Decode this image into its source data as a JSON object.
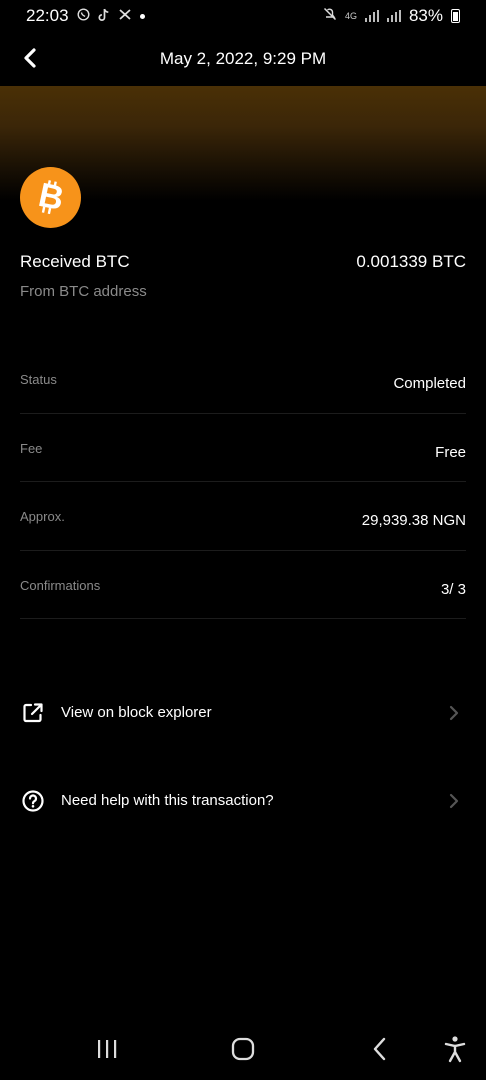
{
  "status_bar": {
    "time": "22:03",
    "battery": "83%",
    "network": "4G"
  },
  "header": {
    "title": "May 2, 2022, 9:29 PM"
  },
  "summary": {
    "title": "Received BTC",
    "amount": "0.001339 BTC",
    "subtitle": "From BTC address",
    "coin_color": "#f7931a"
  },
  "details": [
    {
      "label": "Status",
      "value": "Completed"
    },
    {
      "label": "Fee",
      "value": "Free"
    },
    {
      "label": "Approx.",
      "value": "29,939.38 NGN"
    },
    {
      "label": "Confirmations",
      "value": "3/ 3"
    }
  ],
  "actions": [
    {
      "label": "View on block explorer",
      "icon": "external-link-icon"
    },
    {
      "label": "Need help with this transaction?",
      "icon": "help-circle-icon"
    }
  ],
  "nav_bar": {
    "icons": [
      "recent-apps-icon",
      "home-icon",
      "back-icon",
      "accessibility-icon"
    ]
  }
}
